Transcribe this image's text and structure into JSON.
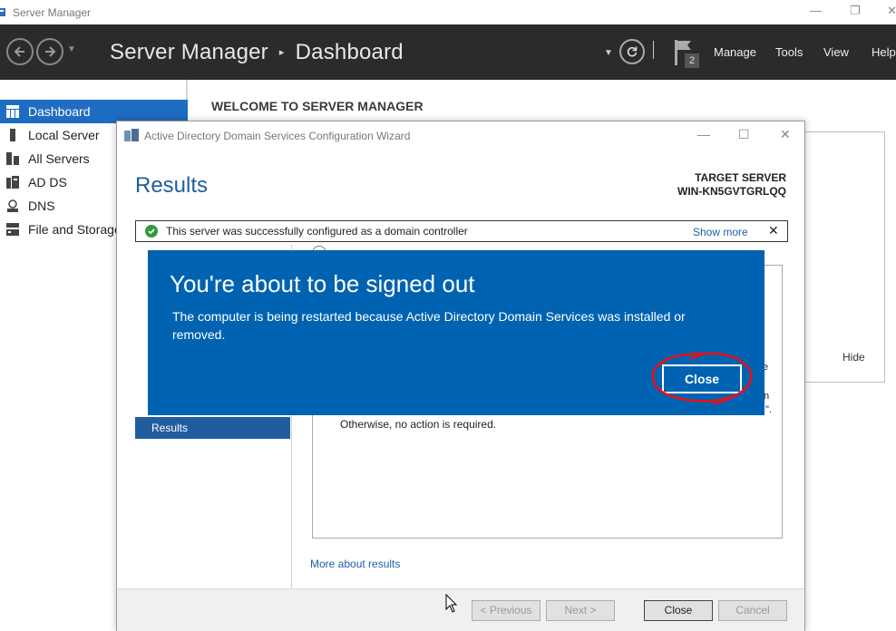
{
  "window": {
    "title": "Server Manager",
    "controls": {
      "minimize": "—",
      "restore": "❐",
      "close": "✕"
    }
  },
  "header": {
    "app_name": "Server Manager",
    "separator": "▸",
    "page": "Dashboard",
    "notification_count": "2",
    "menu": [
      "Manage",
      "Tools",
      "View",
      "Help"
    ]
  },
  "sidebar": {
    "items": [
      {
        "label": "Dashboard",
        "icon": "dashboard-icon",
        "active": true
      },
      {
        "label": "Local Server",
        "icon": "server-icon"
      },
      {
        "label": "All Servers",
        "icon": "servers-icon"
      },
      {
        "label": "AD DS",
        "icon": "ad-ds-icon"
      },
      {
        "label": "DNS",
        "icon": "dns-icon"
      },
      {
        "label": "File and Storage",
        "icon": "storage-icon"
      }
    ]
  },
  "main": {
    "welcome": "WELCOME TO SERVER MANAGER",
    "hide": "Hide"
  },
  "wizard": {
    "title": "Active Directory Domain Services Configuration Wizard",
    "heading": "Results",
    "target_label": "TARGET SERVER",
    "target_name": "WIN-KN5GVTGRLQQ",
    "banner_message": "This server was successfully configured as a domain controller",
    "banner_show_more": "Show more",
    "banner_close": "✕",
    "nav_results": "Results",
    "otherwise_text": "Otherwise, no action is required.",
    "fragments": {
      "e": "e",
      "n": "n",
      "quote": "\"."
    },
    "more_about": "More about results",
    "buttons": {
      "previous": "< Previous",
      "next": "Next >",
      "close": "Close",
      "cancel": "Cancel"
    }
  },
  "signout": {
    "title": "You're about to be signed out",
    "body": "The computer is being restarted because Active Directory Domain Services was installed or removed.",
    "close": "Close",
    "annotation_color": "#e8101a"
  },
  "colors": {
    "header_bg": "#2b2b2b",
    "accent": "#1f6dc2",
    "signout_bg": "#0063b1",
    "wizard_heading": "#215d9e",
    "success": "#2e9a3b"
  }
}
